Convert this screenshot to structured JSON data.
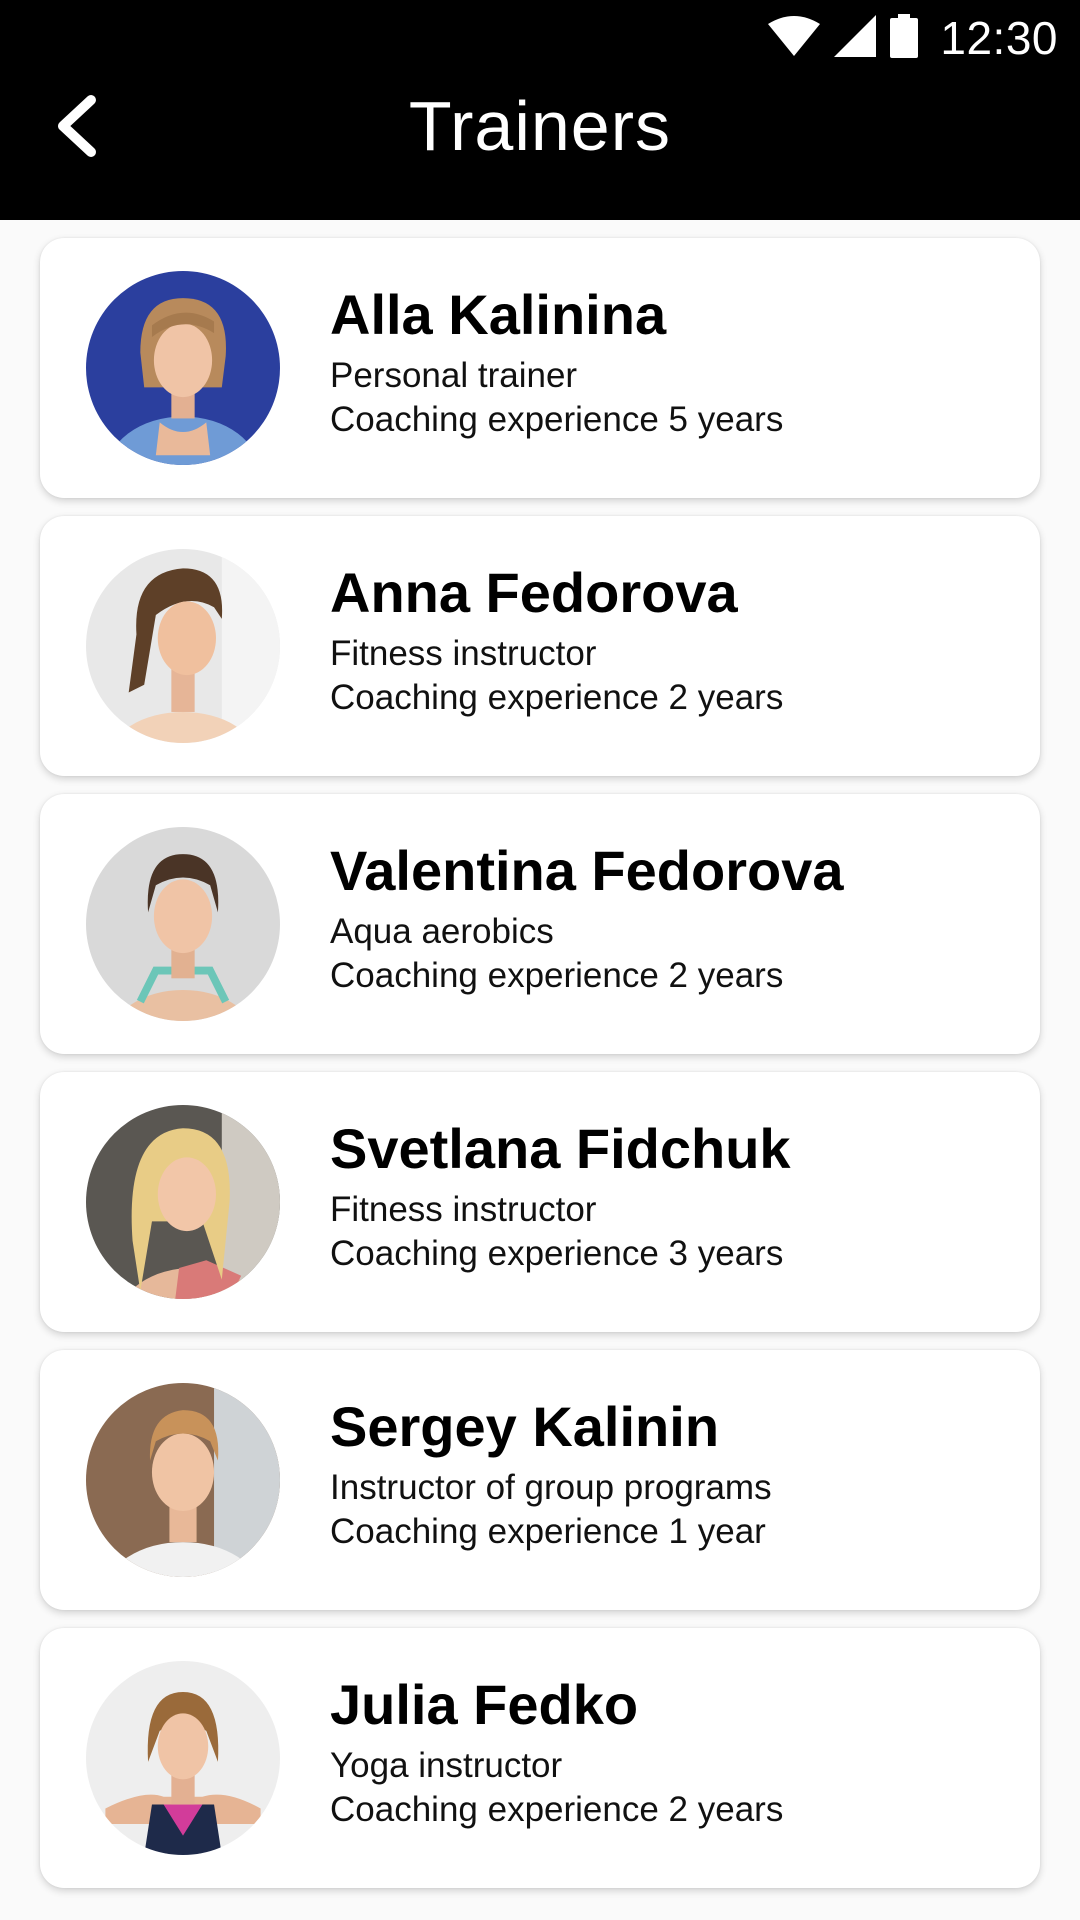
{
  "status_bar": {
    "time": "12:30",
    "icons": [
      "wifi-icon",
      "cellular-signal-icon",
      "battery-icon"
    ]
  },
  "app_bar": {
    "title": "Trainers",
    "back_icon": "chevron-left-icon"
  },
  "colors": {
    "header_background": "#000000",
    "header_text": "#ffffff",
    "card_background": "#ffffff",
    "page_background": "#fafafa"
  },
  "trainers": [
    {
      "name": "Alla Kalinina",
      "role": "Personal trainer",
      "experience": "Coaching experience 5 years"
    },
    {
      "name": "Anna Fedorova",
      "role": "Fitness instructor",
      "experience": "Coaching experience 2 years"
    },
    {
      "name": "Valentina Fedorova",
      "role": "Aqua aerobics",
      "experience": "Coaching experience 2 years"
    },
    {
      "name": "Svetlana Fidchuk",
      "role": "Fitness instructor",
      "experience": "Coaching experience 3 years"
    },
    {
      "name": "Sergey Kalinin",
      "role": "Instructor of group programs",
      "experience": "Coaching experience 1 year"
    },
    {
      "name": "Julia Fedko",
      "role": "Yoga instructor",
      "experience": "Coaching experience 2 years"
    }
  ]
}
